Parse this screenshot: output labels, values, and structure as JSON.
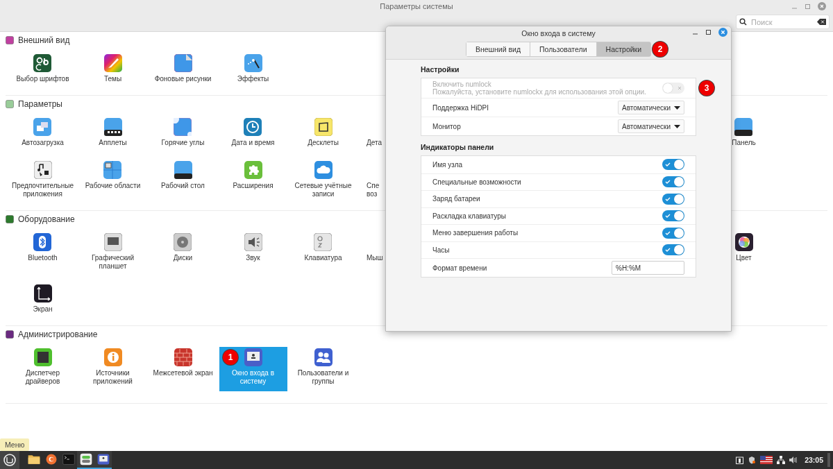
{
  "window": {
    "title": "Параметры системы"
  },
  "search": {
    "placeholder": "Поиск"
  },
  "sections": [
    {
      "title": "Внешний вид",
      "rows": [
        [
          {
            "kind": "app",
            "label": "Выбор шрифтов",
            "selected": false
          },
          {
            "kind": "app",
            "label": "Темы",
            "selected": false
          },
          {
            "kind": "app",
            "label": "Фоновые рисунки",
            "selected": false
          },
          {
            "kind": "app",
            "label": "Эффекты",
            "selected": false
          }
        ]
      ]
    },
    {
      "title": "Параметры",
      "rows": [
        [
          {
            "kind": "app",
            "label": "Автозагрузка",
            "selected": false
          },
          {
            "kind": "app",
            "label": "Апплеты",
            "selected": false
          },
          {
            "kind": "app",
            "label": "Горячие углы",
            "selected": false
          },
          {
            "kind": "app",
            "label": "Дата и время",
            "selected": false
          },
          {
            "kind": "app",
            "label": "Десклеты",
            "selected": false
          },
          {
            "kind": "partial",
            "label": "Дета",
            "selected": false
          },
          {
            "kind": "edge",
            "label": "Панель",
            "selected": false
          }
        ],
        [
          {
            "kind": "app",
            "label": "Предпочтительные приложения",
            "selected": false
          },
          {
            "kind": "app",
            "label": "Рабочие области",
            "selected": false
          },
          {
            "kind": "app",
            "label": "Рабочий стол",
            "selected": false
          },
          {
            "kind": "app",
            "label": "Расширения",
            "selected": false
          },
          {
            "kind": "app",
            "label": "Сетевые учётные записи",
            "selected": false
          },
          {
            "kind": "partial",
            "label": "Спе воз",
            "selected": false
          }
        ]
      ]
    },
    {
      "title": "Оборудование",
      "rows": [
        [
          {
            "kind": "app",
            "label": "Bluetooth",
            "selected": false
          },
          {
            "kind": "app",
            "label": "Графический планшет",
            "selected": false
          },
          {
            "kind": "app",
            "label": "Диски",
            "selected": false
          },
          {
            "kind": "app",
            "label": "Звук",
            "selected": false
          },
          {
            "kind": "app",
            "label": "Клавиатура",
            "selected": false
          },
          {
            "kind": "partial",
            "label": "Мыш",
            "selected": false
          },
          {
            "kind": "edge",
            "label": "Цвет",
            "selected": false
          }
        ],
        [
          {
            "kind": "app",
            "label": "Экран",
            "selected": false
          }
        ]
      ]
    },
    {
      "title": "Администрирование",
      "rows": [
        [
          {
            "kind": "app",
            "label": "Диспетчер драйверов",
            "selected": false
          },
          {
            "kind": "app",
            "label": "Источники приложений",
            "selected": false
          },
          {
            "kind": "app",
            "label": "Межсетевой экран",
            "selected": false
          },
          {
            "kind": "app",
            "label": "Окно входа в систему",
            "selected": true,
            "badge": "1"
          },
          {
            "kind": "app",
            "label": "Пользователи и группы",
            "selected": false
          }
        ]
      ]
    }
  ],
  "dialog": {
    "title": "Окно входа в систему",
    "tabs": [
      {
        "label": "Внешний вид",
        "selected": false
      },
      {
        "label": "Пользователи",
        "selected": false
      },
      {
        "label": "Настройки",
        "selected": true,
        "badge": "2"
      }
    ],
    "groups": [
      {
        "title": "Настройки",
        "rows": [
          {
            "kind": "switch",
            "label": "Включить numlock",
            "hint": "Пожалуйста, установите numlockx для использования этой опции.",
            "on": false,
            "disabled": true,
            "badge": "3"
          },
          {
            "kind": "dropdown",
            "label": "Поддержка HiDPI",
            "value": "Автоматически",
            "disabled": false
          },
          {
            "kind": "dropdown",
            "label": "Монитор",
            "value": "Автоматически",
            "disabled": false
          }
        ]
      },
      {
        "title": "Индикаторы панели",
        "rows": [
          {
            "kind": "switch",
            "label": "Имя узла",
            "on": true,
            "disabled": false
          },
          {
            "kind": "switch",
            "label": "Специальные возможности",
            "on": true,
            "disabled": false
          },
          {
            "kind": "switch",
            "label": "Заряд батареи",
            "on": true,
            "disabled": false
          },
          {
            "kind": "switch",
            "label": "Раскладка клавиатуры",
            "on": true,
            "disabled": false
          },
          {
            "kind": "switch",
            "label": "Меню завершения работы",
            "on": true,
            "disabled": false
          },
          {
            "kind": "switch",
            "label": "Часы",
            "on": true,
            "disabled": false
          },
          {
            "kind": "text",
            "label": "Формат времени",
            "value": "%H:%M",
            "disabled": false
          }
        ]
      }
    ]
  },
  "tooltip": "Меню",
  "taskbar": {
    "apps": [
      {
        "active": false
      },
      {
        "active": false
      },
      {
        "active": false
      },
      {
        "active": true
      },
      {
        "active": true
      }
    ],
    "clock": "23:05"
  }
}
